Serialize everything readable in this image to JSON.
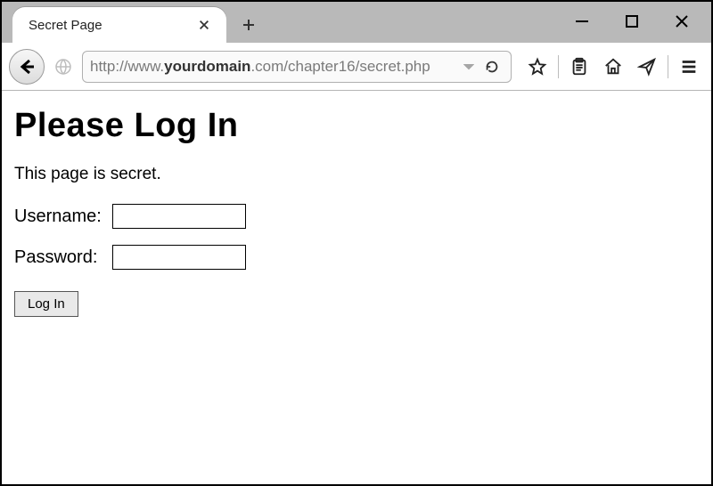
{
  "window": {
    "tab_title": "Secret Page",
    "url_prefix": "http://www.",
    "url_domain": "yourdomain",
    "url_suffix": ".com/chapter16/secret.php"
  },
  "page": {
    "heading": "Please Log In",
    "intro": "This page is secret.",
    "username_label": "Username:",
    "password_label": "Password:",
    "username_value": "",
    "password_value": "",
    "submit_label": "Log In"
  }
}
